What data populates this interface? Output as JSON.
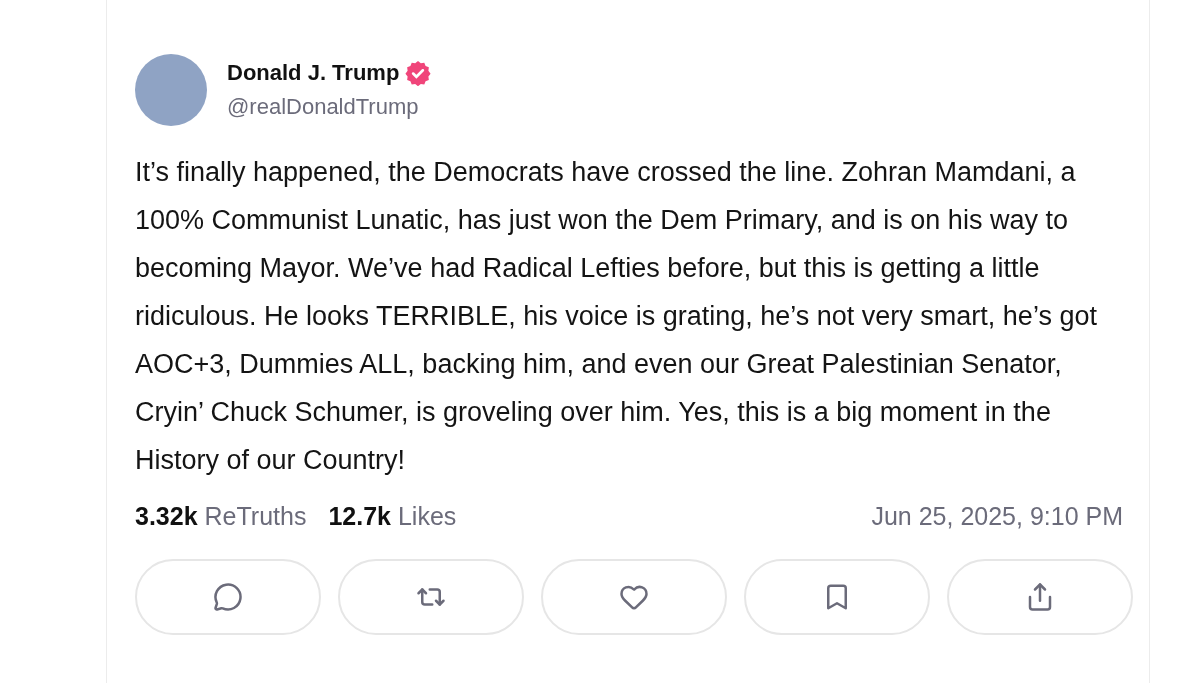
{
  "post": {
    "author": {
      "name": "Donald J. Trump",
      "verified": true,
      "handle": "@realDonaldTrump"
    },
    "body": "It’s finally happened, the Democrats have crossed the line. Zohran Mamdani, a 100% Communist Lunatic, has just won the Dem Primary, and is on his way to becoming Mayor. We’ve had Radical Lefties before, but this is getting a little ridiculous. He looks TERRIBLE, his voice is grating, he’s not very smart, he’s got AOC+3, Dummies ALL, backing him, and even our Great Palestinian Senator, Cryin’ Chuck Schumer, is groveling over him. Yes, this is a big moment in the History of our Country!",
    "stats": [
      {
        "count": "3.32k",
        "label": "ReTruths"
      },
      {
        "count": "12.7k",
        "label": "Likes"
      }
    ],
    "timestamp": "Jun 25, 2025, 9:10 PM"
  }
}
